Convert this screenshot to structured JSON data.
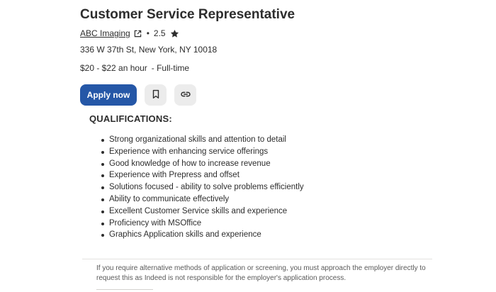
{
  "job": {
    "title": "Customer Service Representative",
    "company": "ABC Imaging",
    "rating": "2.5",
    "address": "336 W 37th St, New York, NY 10018",
    "pay": "$20 - $22 an hour",
    "job_type": "- Full-time"
  },
  "actions": {
    "apply_label": "Apply now",
    "save_icon": "bookmark-icon",
    "share_icon": "link-icon"
  },
  "qualifications": {
    "heading": "QUALIFICATIONS:",
    "items": [
      "Strong organizational skills and attention to detail",
      "Experience with enhancing service offerings",
      "Good knowledge of how to increase revenue",
      "Experience with Prepress and offset",
      "Solutions focused - ability to solve problems efficiently",
      "Ability to communicate effectively",
      "Excellent Customer Service skills and experience",
      "Proficiency with MSOffice",
      "Graphics Application skills and experience"
    ]
  },
  "footer": {
    "disclaimer": "If you require alternative methods of application or screening, you must approach the employer directly to request this as Indeed is not responsible for the employer's application process."
  },
  "colors": {
    "primary_button": "#2557a7",
    "icon_button_bg": "#ececec",
    "text": "#2d2d2d"
  }
}
